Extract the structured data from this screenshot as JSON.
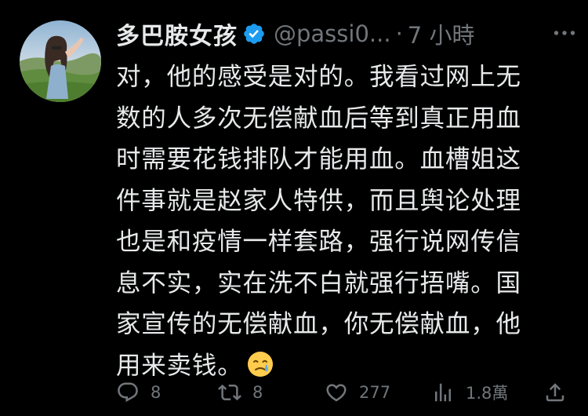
{
  "post": {
    "author": {
      "display_name": "多巴胺女孩",
      "handle": "@passi0...",
      "separator": "·",
      "time": "7 小時",
      "verified": true
    },
    "text_lines": [
      "对，他的感受是对的。我看过网上无",
      "数的人多次无偿献血后等到真正用血",
      "时需要花钱排队才能用血。血槽姐这",
      "件事就是赵家人特供，而且舆论处理",
      "也是和疫情一样套路，强行说网传信",
      "息不实，实在洗不白就强行捂嘴。国",
      "家宣传的无偿献血，你无偿献血，他",
      "用来卖钱。"
    ],
    "emoji": "crying-face",
    "actions": {
      "reply_count": "8",
      "repost_count": "8",
      "like_count": "277",
      "views_count": "1.8萬"
    }
  },
  "colors": {
    "background": "#000000",
    "text": "#e7e9ea",
    "muted": "#71767b",
    "verified": "#1d9bf0"
  }
}
